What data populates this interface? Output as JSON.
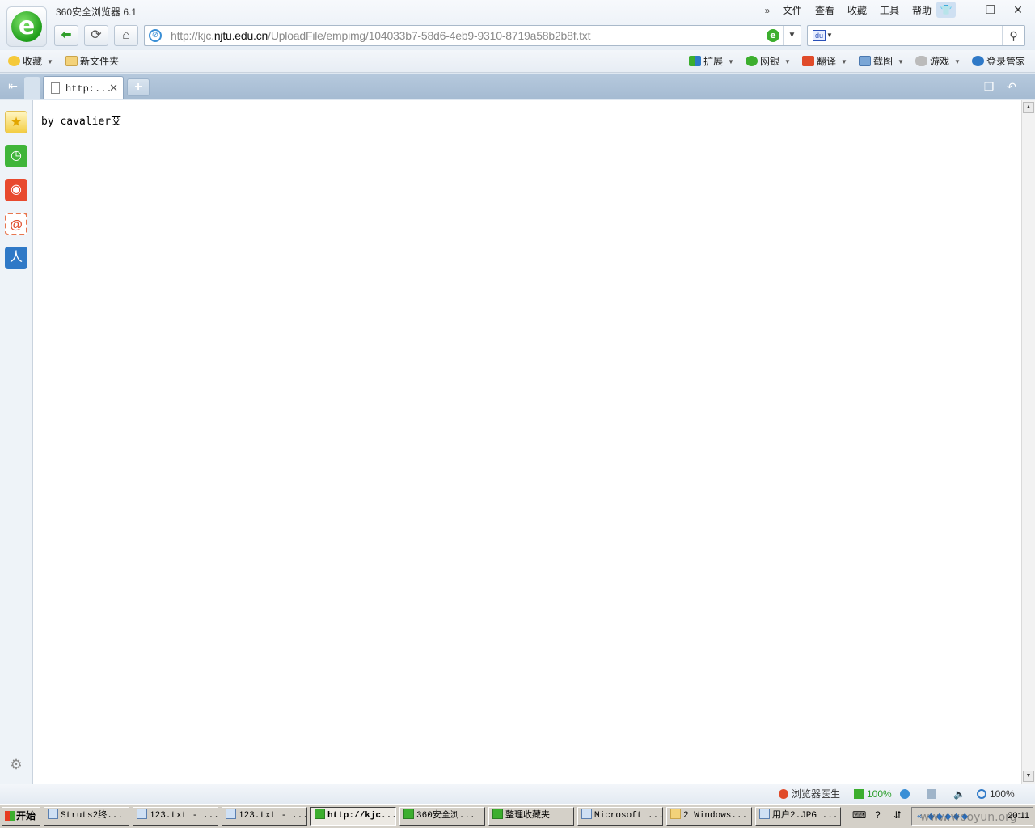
{
  "app": {
    "title": "360安全浏览器 6.1"
  },
  "menu": {
    "chevron": "»",
    "items": [
      "文件",
      "查看",
      "收藏",
      "工具",
      "帮助"
    ]
  },
  "window_controls": {
    "minimize": "—",
    "restore": "❐",
    "close": "✕"
  },
  "address": {
    "url_prefix": "http://kjc.",
    "url_host": "njtu.edu.cn",
    "url_path": "/UploadFile/empimg/104033b7-58d6-4eb9-9310-8719a58b2b8f.txt"
  },
  "search": {
    "value": ""
  },
  "bookmarks": {
    "favorites_label": "收藏",
    "folder_label": "新文件夹",
    "tools": [
      "扩展",
      "网银",
      "翻译",
      "截图",
      "游戏"
    ],
    "login_label": "登录管家"
  },
  "tabs": {
    "active_label": "http:..."
  },
  "content": {
    "text": "by cavalier艾"
  },
  "status": {
    "doctor_label": "浏览器医生",
    "download_label": "100%",
    "zoom_label": "100%"
  },
  "taskbar": {
    "start_label": "开始",
    "items": [
      "Struts2终...",
      "123.txt - ...",
      "123.txt - ...",
      "http://kjc...",
      "360安全浏...",
      "整理收藏夹",
      "Microsoft ...",
      "2 Windows...",
      "用户2.JPG ..."
    ],
    "clock": "20:11"
  },
  "watermark": "www.wooyun.org",
  "colors": {
    "accent_green": "#3cae2e",
    "tab_bar": "#a5bbd2",
    "link_blue": "#3a8fd6"
  }
}
